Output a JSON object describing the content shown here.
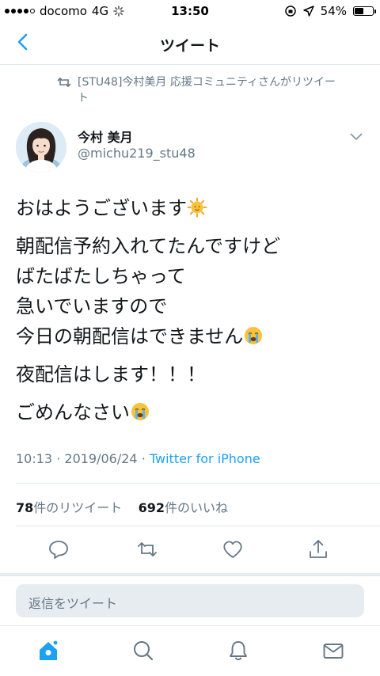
{
  "status_bar": {
    "carrier": "docomo",
    "network": "4G",
    "time": "13:50",
    "battery": "54%",
    "battery_level": 0.54
  },
  "nav": {
    "title": "ツイート",
    "back_icon": "chevron-left-icon"
  },
  "retweet_header": {
    "text": "[STU48]今村美月 応援コミュニティさんがリツイート",
    "icon": "retweet-icon"
  },
  "author": {
    "name": "今村 美月",
    "handle": "@michu219_stu48"
  },
  "tweet": {
    "paragraphs": [
      "おはようございます",
      "朝配信予約入れてたんですけど\nばたばたしちゃって\n急いでいますので\n今日の朝配信はできません",
      "夜配信はします！！！",
      "ごめんなさい"
    ]
  },
  "meta": {
    "time": "10:13",
    "date": "2019/06/24",
    "separator": "·",
    "source": "Twitter for iPhone"
  },
  "counts": {
    "retweets": "78",
    "retweets_label": "件のリツイート",
    "likes": "692",
    "likes_label": "件のいいね"
  },
  "reply": {
    "placeholder": "返信をツイート"
  },
  "colors": {
    "accent": "#1da1f2",
    "muted": "#657786",
    "divider": "#e1e8ed"
  }
}
